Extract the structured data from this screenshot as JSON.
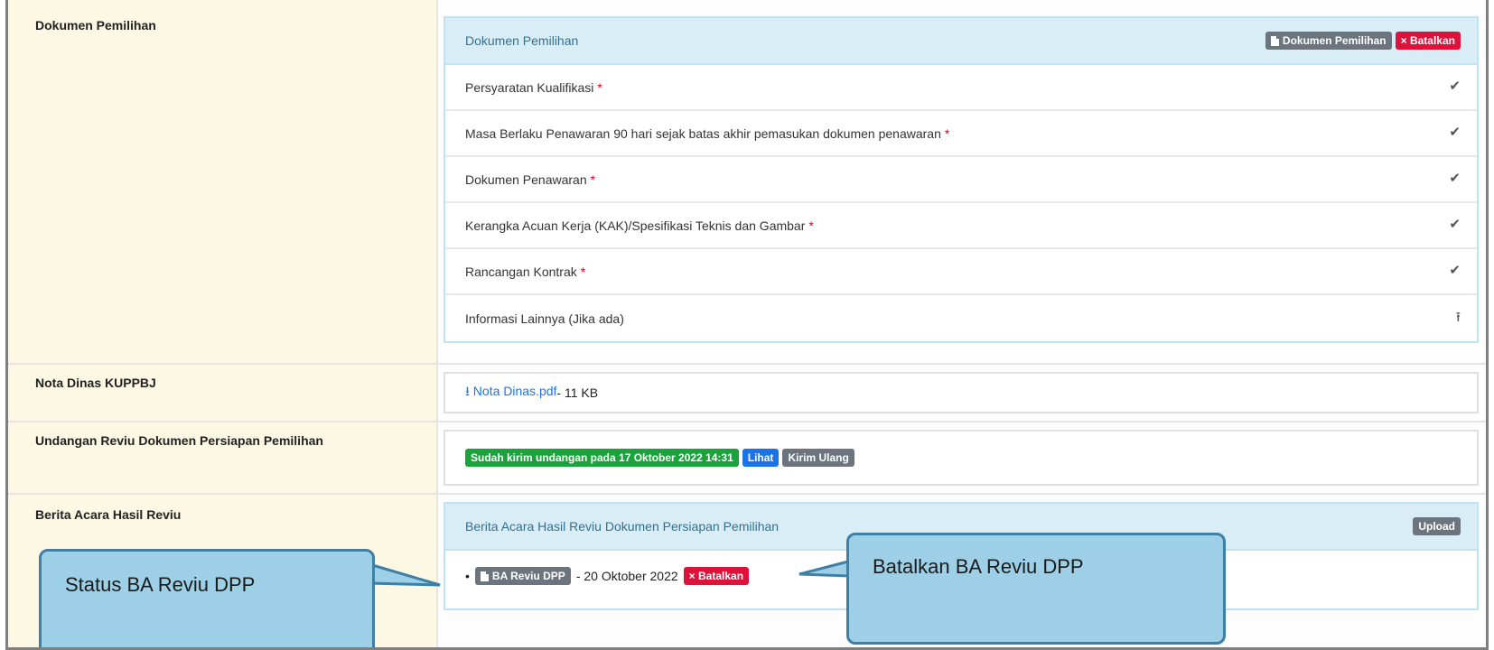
{
  "rows": {
    "dokumen_pemilihan": {
      "label": "Dokumen Pemilihan",
      "panel_title": "Dokumen Pemilihan",
      "btn_dokumen": "Dokumen Pemilihan",
      "btn_batalkan": "× Batalkan",
      "items": [
        {
          "text": "Persyaratan Kualifikasi",
          "required": "*",
          "status": "✔"
        },
        {
          "text": "Masa Berlaku Penawaran 90 hari sejak batas akhir pemasukan dokumen penawaran",
          "required": "*",
          "status": "✔"
        },
        {
          "text": "Dokumen Penawaran",
          "required": "*",
          "status": "✔"
        },
        {
          "text": "Kerangka Acuan Kerja (KAK)/Spesifikasi Teknis dan Gambar",
          "required": "*",
          "status": "✔"
        },
        {
          "text": "Rancangan Kontrak",
          "required": "*",
          "status": "✔"
        },
        {
          "text": "Informasi Lainnya (Jika ada)",
          "required": "",
          "status": "⭱"
        }
      ]
    },
    "nota_dinas": {
      "label": "Nota Dinas KUPPBJ",
      "file_icon": "⭳",
      "file_name": "Nota Dinas.pdf",
      "file_size": " - 11 KB"
    },
    "undangan": {
      "label": "Undangan Reviu Dokumen Persiapan Pemilihan",
      "status_badge": "Sudah kirim undangan pada 17 Oktober 2022 14:31",
      "btn_lihat": "Lihat",
      "btn_kirim_ulang": "Kirim Ulang"
    },
    "berita_acara": {
      "label": "Berita Acara Hasil Reviu",
      "panel_title": "Berita Acara Hasil Reviu Dokumen Persiapan Pemilihan",
      "btn_upload": "Upload",
      "file_badge": "BA Reviu DPP",
      "file_date": " - 20 Oktober 2022",
      "btn_batalkan": "× Batalkan"
    }
  },
  "callouts": {
    "status": "Status BA Reviu DPP",
    "batalkan": "Batalkan BA Reviu DPP"
  },
  "colors": {
    "label_bg": "#fcf8e3",
    "panel_head_bg": "#d9edf7",
    "danger": "#dc143c",
    "success": "#1aa33a",
    "primary": "#1a73e8",
    "callout_bg": "#9dd0e6"
  }
}
